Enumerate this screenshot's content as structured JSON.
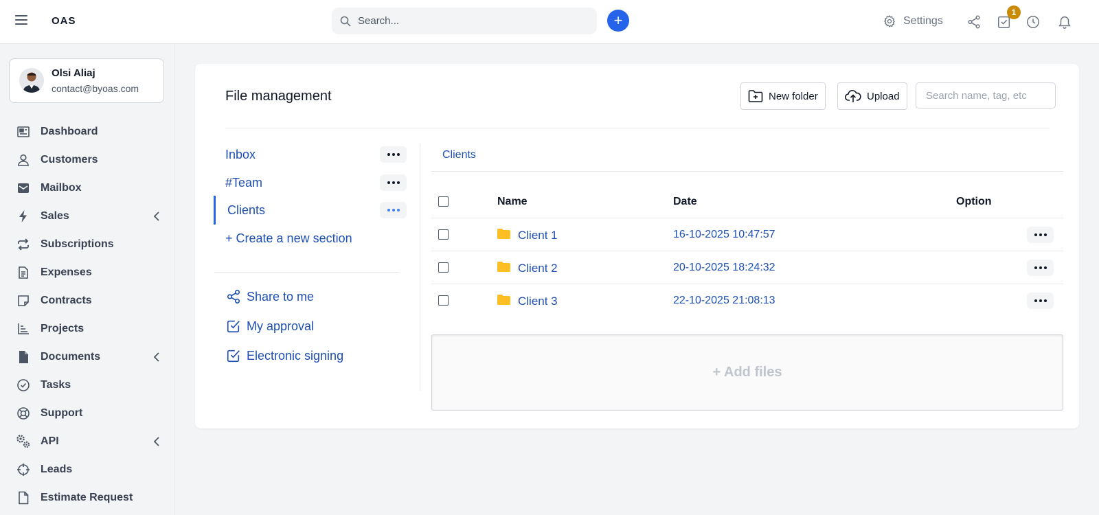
{
  "header": {
    "logo": "OAS",
    "search_placeholder": "Search...",
    "settings_label": "Settings",
    "tasks_badge": "1",
    "accent_color": "#2563eb"
  },
  "user": {
    "name": "Olsi Aliaj",
    "email": "contact@byoas.com"
  },
  "sidebar": {
    "items": [
      {
        "label": "Dashboard",
        "icon": "dashboard-icon"
      },
      {
        "label": "Customers",
        "icon": "user-icon"
      },
      {
        "label": "Mailbox",
        "icon": "mail-icon"
      },
      {
        "label": "Sales",
        "icon": "bolt-icon",
        "has_submenu": true
      },
      {
        "label": "Subscriptions",
        "icon": "repeat-icon"
      },
      {
        "label": "Expenses",
        "icon": "receipt-icon"
      },
      {
        "label": "Contracts",
        "icon": "note-icon"
      },
      {
        "label": "Projects",
        "icon": "chart-icon"
      },
      {
        "label": "Documents",
        "icon": "document-icon",
        "has_submenu": true
      },
      {
        "label": "Tasks",
        "icon": "check-circle-icon"
      },
      {
        "label": "Support",
        "icon": "lifebuoy-icon"
      },
      {
        "label": "API",
        "icon": "gears-icon",
        "has_submenu": true
      },
      {
        "label": "Leads",
        "icon": "crosshair-icon"
      },
      {
        "label": "Estimate Request",
        "icon": "file-icon"
      }
    ]
  },
  "file_management": {
    "title": "File management",
    "new_folder_label": "New folder",
    "upload_label": "Upload",
    "search_placeholder": "Search name, tag, etc",
    "sections": [
      {
        "label": "Inbox",
        "active": false
      },
      {
        "label": "#Team",
        "active": false
      },
      {
        "label": "Clients",
        "active": true
      }
    ],
    "create_section_label": "+ Create a new section",
    "shortcuts": [
      {
        "label": "Share to me",
        "icon": "share-icon"
      },
      {
        "label": "My approval",
        "icon": "checkbox-icon"
      },
      {
        "label": "Electronic signing",
        "icon": "checkbox-icon"
      }
    ],
    "breadcrumb": "Clients",
    "table": {
      "columns": [
        "Name",
        "Date",
        "Option"
      ],
      "rows": [
        {
          "name": "Client 1",
          "date": "16-10-2025 10:47:57"
        },
        {
          "name": "Client 2",
          "date": "20-10-2025 18:24:32"
        },
        {
          "name": "Client 3",
          "date": "22-10-2025 21:08:13"
        }
      ]
    },
    "add_files_label": "+ Add files"
  }
}
